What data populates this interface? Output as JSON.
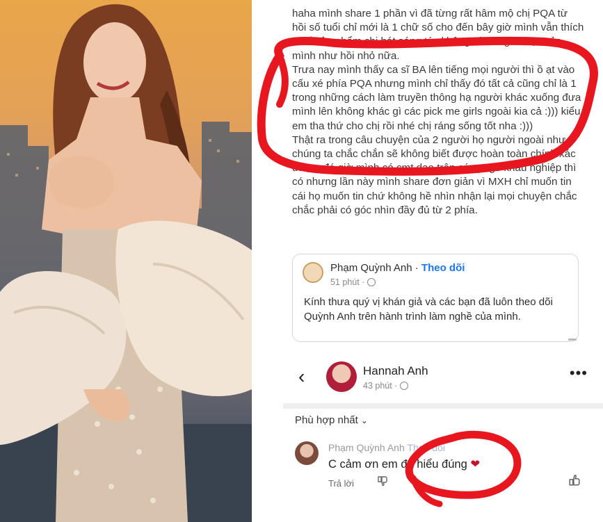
{
  "post": {
    "paragraphs": [
      "haha mình share 1 phần vì đã từng rất hâm mộ chị PQA từ hồi số tuổi chỉ mới là 1 chữ số cho đến bây giờ mình vẫn thích 1 số sản phẩm chị hát sáng tác không còn là gu nhạc của mình như hồi nhỏ nữa.",
      "Trưa nay mình thấy ca sĩ BA lên tiếng mọi người thì ồ ạt vào cấu xé phía PQA nhưng mình chỉ thấy đó tất cả cũng chỉ là 1 trong những cách làm truyền thông hạ người khác xuống đưa mình lên không khác gì các pick me girls ngoài kia cả :))) kiểu em tha thứ cho chị rồi nhé chị ráng sống tốt nha :)))",
      "Thật ra trong câu chuyện của 2 người họ người ngoài như chúng ta chắc chắn sẽ không biết được hoàn toàn chính xác được, đó giờ mình có cmt dạo trên các page khẩu nghiệp thì có nhưng lần này mình share đơn giản vì MXH chỉ muốn tin cái họ muốn tin chứ không hề nhìn nhận lại mọi chuyện chắc chắc phải có góc nhìn đầy đủ từ 2 phía."
    ]
  },
  "shared_post": {
    "author": "Phạm Quỳnh Anh",
    "separator": " · ",
    "follow_label": "Theo dõi",
    "time": "51 phút ·",
    "body": "Kính thưa quý vị khán giả và các bạn đã luôn theo dõi Quỳnh Anh trên hành trình làm nghề của mình."
  },
  "header": {
    "back_glyph": "‹",
    "name": "Hannah Anh",
    "time": "43 phút ·",
    "more_glyph": "•••"
  },
  "comments": {
    "sort_label": "Phù hợp nhất",
    "sort_chevron": "⌄",
    "items": [
      {
        "author": "Phạm Quỳnh Anh",
        "follow_label": "Theo dõi",
        "text": "C cảm ơn em đã hiểu đúng",
        "heart": "❤",
        "reply_label": "Trả lời"
      }
    ]
  },
  "icons": {
    "dislike": "dislike-icon",
    "like": "like-icon",
    "globe": "globe-icon"
  },
  "colors": {
    "facebook_blue": "#1877f2",
    "annotation_red": "#e8171f",
    "heart_red": "#c0182a"
  }
}
